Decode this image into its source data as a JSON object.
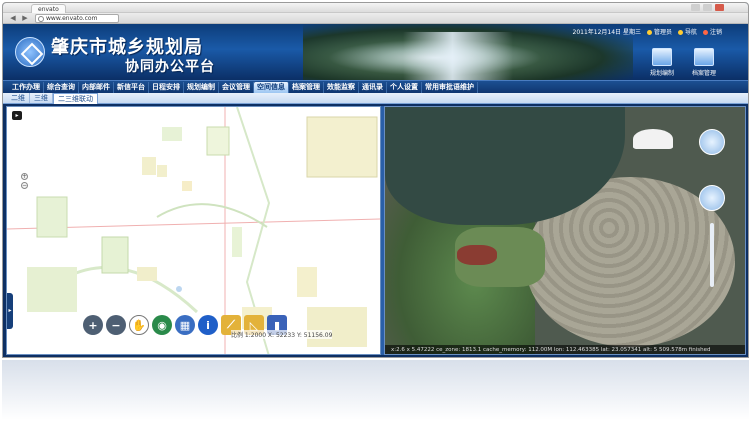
{
  "browser": {
    "tab_title": "envato",
    "url": "www.envato.com"
  },
  "header": {
    "title": "肇庆市城乡规划局",
    "subtitle": "协同办公平台",
    "date_text": "2011年12月14日 星期三",
    "user_label": "管理员",
    "nav_label": "导航",
    "logout_label": "注销",
    "quick_buttons": [
      "规划编制",
      "档案管理"
    ]
  },
  "main_nav": {
    "items": [
      "工作办理",
      "综合查询",
      "内部邮件",
      "新信平台",
      "日程安排",
      "规划编制",
      "会议管理",
      "空间信息",
      "档案管理",
      "效能监察",
      "通讯录",
      "个人设置",
      "常用审批语维护"
    ],
    "active_index": 7
  },
  "sub_nav": {
    "items": [
      "二维",
      "三维",
      "二三维联动"
    ],
    "active_index": 2
  },
  "map2d": {
    "coord_text": "比例 1:2000  X: 52233  Y: 51156.09"
  },
  "map3d": {
    "status_text": "x:2.6 x 5.47222  ce_zone: 1813.1  cache_memory: 112.00M  lon: 112.463385  lat: 23.057341  alt: 5 509.578m  finished"
  }
}
